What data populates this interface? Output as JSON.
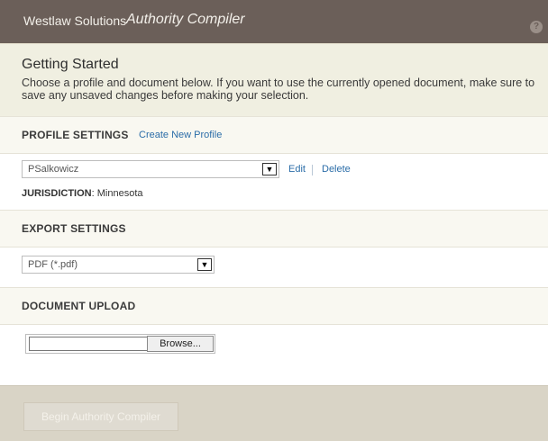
{
  "header": {
    "brand": "Westlaw Solutions",
    "product": "Authority Compiler",
    "help_glyph": "?"
  },
  "getting_started": {
    "title": "Getting Started",
    "description": "Choose a profile and document below. If you want to use the currently opened document, make sure to save any unsaved changes before making your selection."
  },
  "profile_settings": {
    "title": "PROFILE SETTINGS",
    "create_link": "Create New Profile",
    "selected_profile": "PSalkowicz",
    "edit_link": "Edit",
    "delete_link": "Delete",
    "jurisdiction_label": "JURISDICTION",
    "jurisdiction_value": ": Minnesota"
  },
  "export_settings": {
    "title": "EXPORT SETTINGS",
    "selected_format": "PDF (*.pdf)"
  },
  "document_upload": {
    "title": "DOCUMENT UPLOAD",
    "browse_label": "Browse..."
  },
  "footer": {
    "begin_label": "Begin Authority Compiler"
  },
  "icons": {
    "dropdown": "chevron-down-icon",
    "help": "help-icon"
  },
  "colors": {
    "titlebar": "#6b5f59",
    "link": "#2b6da8",
    "getting_started_bg": "#f0efe1",
    "footer_bg": "#d9d4c6"
  }
}
